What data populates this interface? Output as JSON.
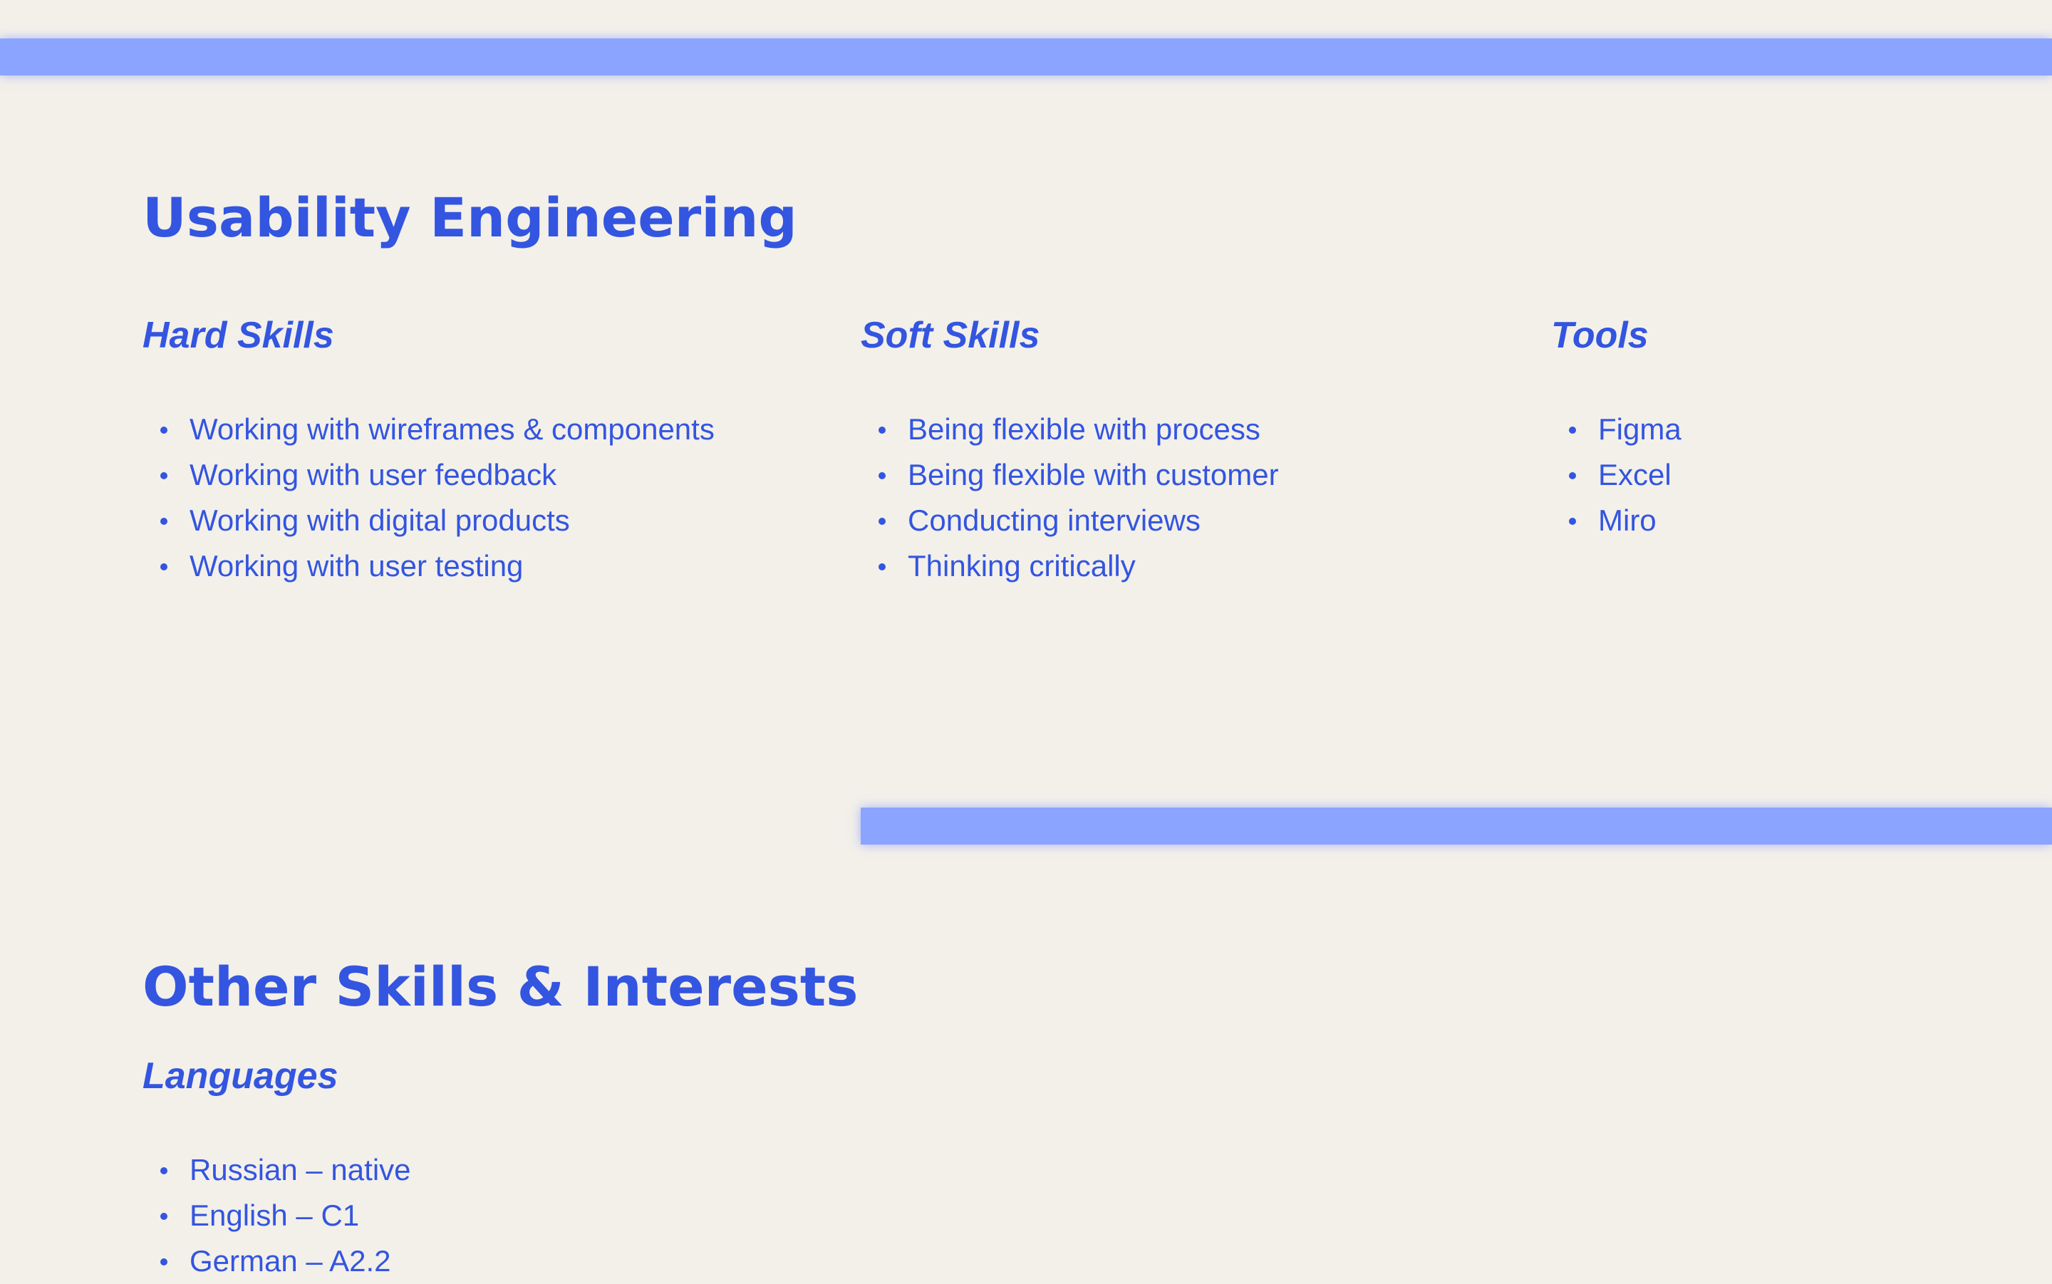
{
  "colors": {
    "background": "#f3f0ea",
    "text": "#3355e0",
    "accent_bar": "#8aa4ff"
  },
  "usability": {
    "title": "Usability Engineering",
    "hard_skills": {
      "heading": "Hard Skills",
      "items": [
        "Working with wireframes & components",
        "Working with user feedback",
        "Working with digital products",
        "Working with user testing"
      ]
    },
    "soft_skills": {
      "heading": "Soft Skills",
      "items": [
        "Being flexible with process",
        "Being flexible with customer",
        "Conducting interviews",
        "Thinking critically"
      ]
    },
    "tools": {
      "heading": "Tools",
      "items": [
        "Figma",
        "Excel",
        "Miro"
      ]
    }
  },
  "other": {
    "title": "Other Skills & Interests",
    "languages": {
      "heading": "Languages",
      "items": [
        "Russian – native",
        "English – C1",
        "German – A2.2"
      ]
    }
  }
}
